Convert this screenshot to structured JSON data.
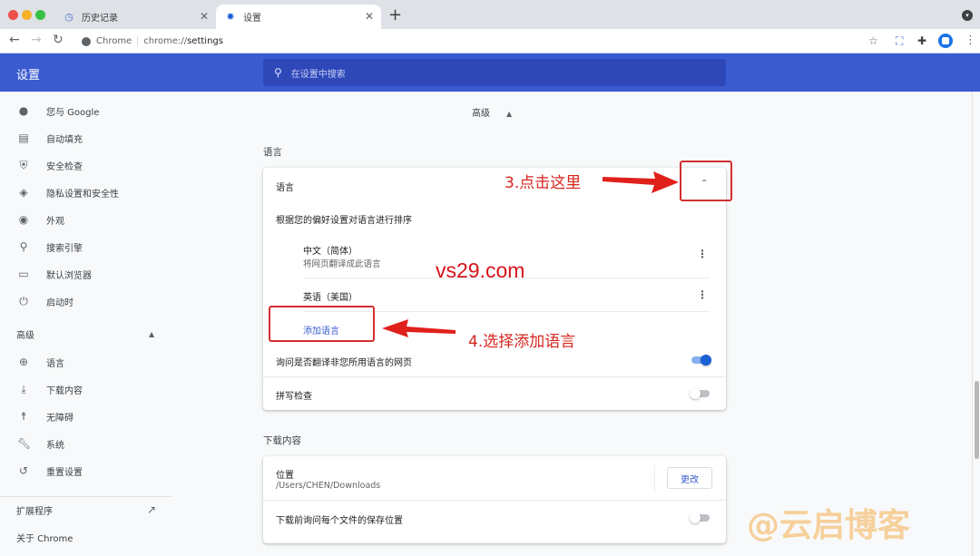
{
  "browser": {
    "tabs": [
      {
        "label": "历史记录",
        "icon": "history-icon",
        "active": false
      },
      {
        "label": "设置",
        "icon": "gear-icon",
        "active": true
      }
    ],
    "omnibox": {
      "chip": "Chrome",
      "url_prefix": "chrome://",
      "url_path": "settings"
    }
  },
  "header": {
    "title": "设置",
    "search_placeholder": "在设置中搜索"
  },
  "sidebar": {
    "items": [
      {
        "label": "您与 Google",
        "icon": "person-icon"
      },
      {
        "label": "自动填充",
        "icon": "clipboard-icon"
      },
      {
        "label": "安全检查",
        "icon": "shield-check-icon"
      },
      {
        "label": "隐私设置和安全性",
        "icon": "privacy-shield-icon"
      },
      {
        "label": "外观",
        "icon": "palette-icon"
      },
      {
        "label": "搜索引擎",
        "icon": "search-icon"
      },
      {
        "label": "默认浏览器",
        "icon": "browser-icon"
      },
      {
        "label": "启动时",
        "icon": "power-icon"
      }
    ],
    "advanced_label": "高级",
    "advanced_items": [
      {
        "label": "语言",
        "icon": "globe-icon"
      },
      {
        "label": "下载内容",
        "icon": "download-icon"
      },
      {
        "label": "无障碍",
        "icon": "accessibility-icon"
      },
      {
        "label": "系统",
        "icon": "wrench-icon"
      },
      {
        "label": "重置设置",
        "icon": "restore-icon"
      }
    ],
    "extensions_label": "扩展程序",
    "about_label": "关于 Chrome"
  },
  "main": {
    "advanced_toggle": "高级",
    "languages_section": {
      "title": "语言",
      "card_title": "语言",
      "order_hint": "根据您的偏好设置对语言进行排序",
      "languages": [
        {
          "name": "中文（简体）",
          "sub": "将网页翻译成此语言"
        },
        {
          "name": "英语（美国）",
          "sub": ""
        }
      ],
      "add_language": "添加语言",
      "translate_offer": {
        "label": "询问是否翻译非您所用语言的网页",
        "enabled": true
      },
      "spell_check": {
        "label": "拼写检查",
        "enabled": false
      }
    },
    "downloads_section": {
      "title": "下载内容",
      "location_label": "位置",
      "location_path": "/Users/CHEN/Downloads",
      "change_button": "更改",
      "ask_where": {
        "label": "下载前询问每个文件的保存位置",
        "enabled": false
      }
    }
  },
  "annotations": {
    "step3": "3.点击这里",
    "step4": "4.选择添加语言",
    "watermark_site": "vs29.com",
    "watermark_blog": "@云启博客",
    "color": "#d7261f"
  }
}
